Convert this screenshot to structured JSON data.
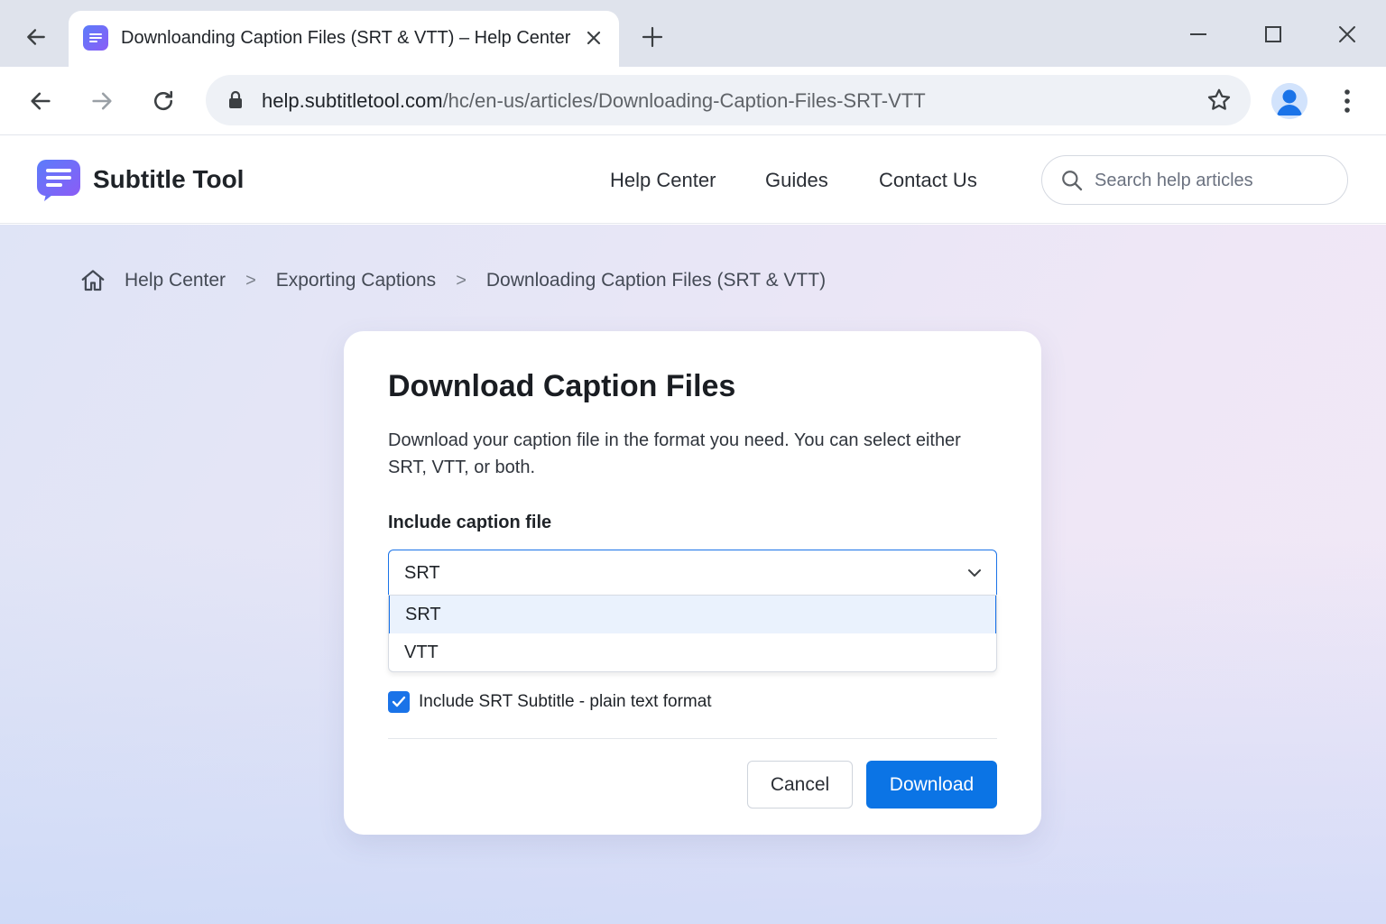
{
  "browser": {
    "tab": {
      "title": "Downloanding Caption Files (SRT & VTT) – Help Center",
      "favicon_icon": "subtitle-tool-favicon"
    },
    "address_bar": {
      "url_host": "help.subtitletool.com",
      "url_path": "/hc/en-us/articles/Downloading-Caption-Files-SRT-VTT"
    },
    "icons": [
      "back-icon",
      "forward-icon",
      "reload-icon",
      "lock-icon",
      "star-icon",
      "profile-icon",
      "more-vert-icon",
      "new-tab-icon",
      "minimize-icon",
      "maximize-icon",
      "close-icon"
    ]
  },
  "site": {
    "brand": "Subtitle Tool",
    "nav": [
      "Help Center",
      "Guides",
      "Contact Us"
    ],
    "search": {
      "placeholder": "Search help articles",
      "value": ""
    }
  },
  "breadcrumb": {
    "items": [
      "Help Center",
      "Exporting Captions",
      "Downloading Caption Files (SRT & VTT)"
    ],
    "separator": ">"
  },
  "dialog": {
    "title": "Download Caption Files",
    "description": "Download your caption file in the format you need. You can select either SRT, VTT, or both.",
    "field_label": "Include caption file",
    "select": {
      "value": "SRT",
      "options": [
        "SRT",
        "VTT"
      ],
      "highlighted": "SRT"
    },
    "checkbox": {
      "label": "Include SRT Subtitle - plain text format",
      "checked": true
    },
    "cancel_label": "Cancel",
    "download_label": "Download"
  },
  "colors": {
    "accent": "#1a73e8",
    "primary_button": "#0b74e5",
    "brand_gradient_start": "#5b7cfa",
    "brand_gradient_end": "#8b5cf6"
  }
}
